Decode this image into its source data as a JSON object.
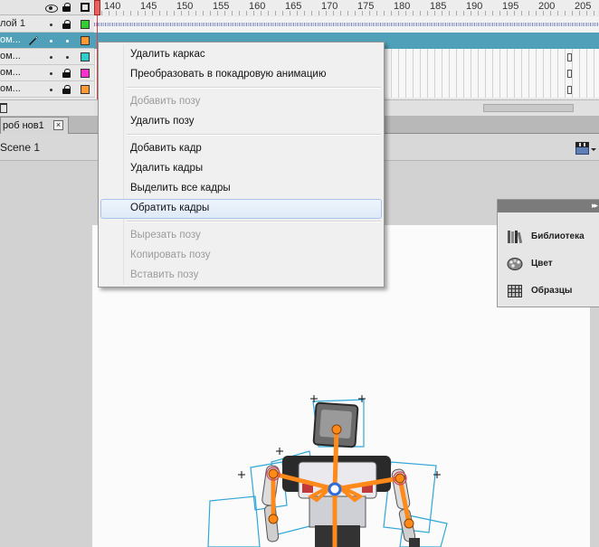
{
  "timeline": {
    "ruler_labels": [
      "140",
      "145",
      "150",
      "155",
      "160",
      "165",
      "170",
      "175",
      "180",
      "185",
      "190",
      "195",
      "200",
      "205"
    ],
    "layers": [
      {
        "name": "лой 1",
        "color": "#33cc33",
        "type": "audio"
      },
      {
        "name": "ом...",
        "color": "#ff9933",
        "type": "selected"
      },
      {
        "name": "ом...",
        "color": "#33cccc",
        "type": "normal"
      },
      {
        "name": "ом...",
        "color": "#ff33cc",
        "type": "normal"
      },
      {
        "name": "ом...",
        "color": "#ff9933",
        "type": "normal"
      }
    ]
  },
  "doc_tab": {
    "label": "роб нов1",
    "close_glyph": "×"
  },
  "editbar": {
    "scene": "Scene 1"
  },
  "context_menu": {
    "items": [
      {
        "label": "Удалить каркас",
        "enabled": true
      },
      {
        "label": "Преобразовать в покадровую анимацию",
        "enabled": true
      },
      {
        "label": "Добавить позу",
        "enabled": false
      },
      {
        "label": "Удалить позу",
        "enabled": true
      },
      {
        "label": "Добавить кадр",
        "enabled": true
      },
      {
        "label": "Удалить кадры",
        "enabled": true
      },
      {
        "label": "Выделить все кадры",
        "enabled": true
      },
      {
        "label": "Обратить кадры",
        "enabled": true,
        "hover": true
      },
      {
        "label": "Вырезать позу",
        "enabled": false
      },
      {
        "label": "Копировать позу",
        "enabled": false
      },
      {
        "label": "Вставить позу",
        "enabled": false
      }
    ]
  },
  "panel": {
    "expand_glyph": "▸▸",
    "items": [
      {
        "label": "Библиотека",
        "icon": "library-icon"
      },
      {
        "label": "Цвет",
        "icon": "color-palette-icon"
      },
      {
        "label": "Образцы",
        "icon": "swatches-icon"
      }
    ]
  },
  "colors": {
    "selected_layer": "#4fa0b8",
    "armature": "#ff8a1a",
    "bone_outline": "#2fa7d8",
    "menu_hover": "#dfeaf8"
  }
}
